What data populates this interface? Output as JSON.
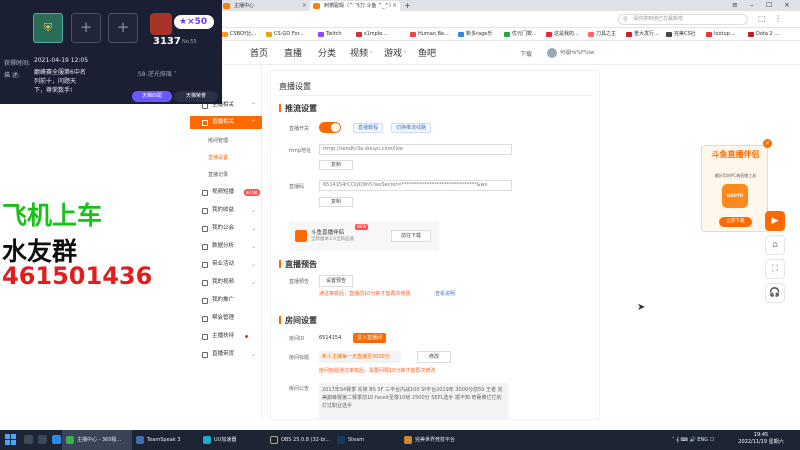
{
  "browser": {
    "tabs": [
      {
        "label": "主播中心",
        "active": false
      },
      {
        "label": "刺猬驱瑕（^ 飞刀 斗鱼 ^_^）",
        "active": true
      }
    ],
    "search_placeholder": "请你搜到他已在最新啦",
    "bookmarks": [
      "CSBOY比...",
      "CS:GO For...",
      "Twitch",
      "s1mple...",
      "Human Be...",
      "新多rage乐",
      "优元门数...",
      "这是我的...",
      "刀具之主",
      "重大发行...",
      "完美CS社",
      "lootup...",
      "Dota 2 ..."
    ]
  },
  "site": {
    "logo": "斗鱼",
    "nav": [
      "首页",
      "直播",
      "分类",
      "视频",
      "游戏",
      "鱼吧"
    ],
    "download": "下载",
    "username": "何福Hs%F%iw"
  },
  "overlay": {
    "slot_empty": "+",
    "stars": "★×50",
    "score": "3137",
    "rank": "No.55",
    "date_label": "获得时间:",
    "date_value": "2021-04-19 12:05",
    "desc_label": "描    述:",
    "desc_lines": [
      "巅峰赛全服第6中名",
      "列前十，问题天",
      "下，尊荣数手!"
    ],
    "season": "S8-逆光探璃 ˅",
    "btn_match": "天梯匹配",
    "btn_rank": "天梯荣誉"
  },
  "left_text": {
    "line1": "飞机上车",
    "line2": "水友群",
    "line3": "461501436"
  },
  "sidebar": {
    "head": "中心",
    "items": [
      {
        "label": "主播相关",
        "arrow": "⌃"
      },
      {
        "label": "直播相关",
        "arrow": "⌃",
        "active": true
      },
      {
        "label": "视频短播",
        "badge": "新功能"
      },
      {
        "label": "我的收益",
        "arrow": "⌄"
      },
      {
        "label": "我的公会",
        "arrow": "⌄"
      },
      {
        "label": "数据分析",
        "arrow": "⌄"
      },
      {
        "label": "带业活动",
        "arrow": "⌄"
      },
      {
        "label": "我的视频",
        "arrow": "⌄"
      },
      {
        "label": "我的推广"
      },
      {
        "label": "帮会管理"
      },
      {
        "label": "主播扶持",
        "dot": true
      },
      {
        "label": "直播带货",
        "arrow": "⌄"
      }
    ],
    "subitems": [
      "房间管理",
      "直播设置",
      "直播记录"
    ]
  },
  "main": {
    "title": "直播设置",
    "stream_section": "推流设置",
    "switch_label": "直播开关",
    "pill1": "直播教程",
    "pill2": "切换推流线路",
    "rtmp_label": "rtmp地址",
    "rtmp_value": "rtmp://sendtc3a.douyu.com/live",
    "copy": "复制",
    "code_label": "直播码",
    "code_value": "6514154rCCkJO9h5?wsSecret=******************************&ws",
    "promo_title": "斗鱼直播伴侣",
    "promo_new": "NEW",
    "promo_sub": "全新版本3.0全新品质",
    "promo_btn": "前往下载",
    "notice_section": "直播预告",
    "notice_label": "直播预告",
    "notice_btn": "设置预告",
    "notice_tip": "通过审核后，直播前10分钟才能再次修改",
    "notice_link": "查看说明",
    "room_section": "房间设置",
    "room_label": "房间ID",
    "room_id": "6514154",
    "room_badge": "进入直播间",
    "title_label": "房间标题",
    "title_value": "新人主播每一天直播至3000分",
    "modify": "修改",
    "title_tip": "房间标题通过审核后，需要间隔10分钟才能再次修改",
    "announce_label": "房间公告",
    "announce_text": "2017年S4赛季 先锋 BS SF 三平台内战100 Sf平台2019年 3000分前50 王者 完美巅峰赛第二赛季前10 faceit至尊10级 2500分 5EPL选手 顺不知 奇葩黄烂烂的打过职业选手"
  },
  "ad": {
    "title": "斗鱼直播伴侣",
    "sub": "最好用的PC端直播工具",
    "btn": "立即下载",
    "close": "×"
  },
  "floatbar": [
    "▶",
    "⌂",
    "⛶",
    "🎧"
  ],
  "taskbar": {
    "apps": [
      "主播中心 - 360极...",
      "TeamSpeak 3",
      "UU加速器",
      "OBS 25.0.8 (32-bi...",
      "Steam",
      "完美世界竞技平台"
    ],
    "tray": "˄ 𝄞 ⌨ 🔊 ENG ☐",
    "time": "19:45",
    "date": "2022/11/19 星期六"
  }
}
